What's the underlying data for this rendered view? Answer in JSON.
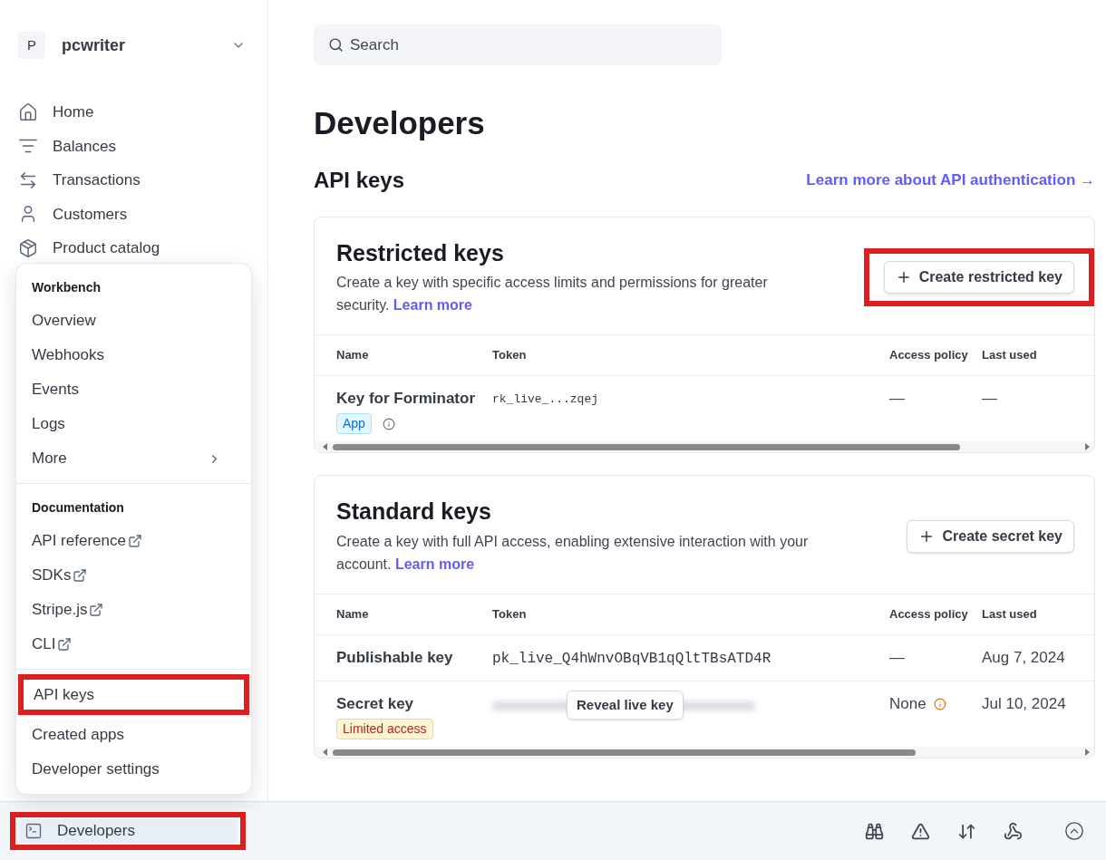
{
  "account": {
    "initial": "P",
    "name": "pcwriter"
  },
  "sidebar": {
    "items": [
      {
        "label": "Home"
      },
      {
        "label": "Balances"
      },
      {
        "label": "Transactions"
      },
      {
        "label": "Customers"
      },
      {
        "label": "Product catalog"
      }
    ]
  },
  "popover": {
    "sections": [
      {
        "heading": "Workbench",
        "items": [
          {
            "label": "Overview",
            "kind": "plain",
            "highlighted": false
          },
          {
            "label": "Webhooks",
            "kind": "plain",
            "highlighted": false
          },
          {
            "label": "Events",
            "kind": "plain",
            "highlighted": false
          },
          {
            "label": "Logs",
            "kind": "plain",
            "highlighted": false
          },
          {
            "label": "More",
            "kind": "submenu",
            "highlighted": false
          }
        ]
      },
      {
        "heading": "Documentation",
        "items": [
          {
            "label": "API reference",
            "kind": "external",
            "highlighted": false
          },
          {
            "label": "SDKs",
            "kind": "external",
            "highlighted": false
          },
          {
            "label": "Stripe.js",
            "kind": "external",
            "highlighted": false
          },
          {
            "label": "CLI",
            "kind": "external",
            "highlighted": false
          }
        ]
      },
      {
        "items": [
          {
            "label": "API keys",
            "kind": "plain",
            "highlighted": true
          },
          {
            "label": "Created apps",
            "kind": "plain",
            "highlighted": false
          },
          {
            "label": "Developer settings",
            "kind": "plain",
            "highlighted": false
          }
        ]
      }
    ]
  },
  "bottom_bar": {
    "developers": {
      "label": "Developers",
      "highlighted": true
    }
  },
  "search": {
    "placeholder": "Search"
  },
  "page": {
    "title": "Developers",
    "section_title": "API keys",
    "link": "Learn more about API authentication →"
  },
  "cards": [
    {
      "title": "Restricted keys",
      "description": "Create a key with specific access limits and permissions for greater security.",
      "learn_more": "Learn more",
      "button": {
        "label": "Create restricted key",
        "highlighted": true
      },
      "columns": [
        "Name",
        "Token",
        "Access policy",
        "Last used"
      ],
      "rows": [
        {
          "name": "Key for Forminator",
          "token": "rk_live_...zqej",
          "blurred": false,
          "badge": {
            "text": "App",
            "kind": "app"
          },
          "info_icon": true,
          "access_policy": "—",
          "policy_warning": false,
          "last_used": "—"
        }
      ]
    },
    {
      "title": "Standard keys",
      "description": "Create a key with full API access, enabling extensive interaction with your account.",
      "learn_more": "Learn more",
      "button": {
        "label": "Create secret key",
        "highlighted": false
      },
      "columns": [
        "Name",
        "Token",
        "Access policy",
        "Last used"
      ],
      "rows": [
        {
          "name": "Publishable key",
          "token": "pk_live_Q4hWnvOBqVB1qQltTBsATD4R",
          "blurred": false,
          "access_policy": "—",
          "policy_warning": false,
          "last_used": "Aug 7, 2024"
        },
        {
          "name": "Secret key",
          "blurred": true,
          "reveal": "Reveal live key",
          "badge": {
            "text": "Limited access",
            "kind": "limited"
          },
          "info_icon": false,
          "access_policy": "None",
          "policy_warning": true,
          "last_used": "Jul 10, 2024"
        }
      ]
    }
  ]
}
